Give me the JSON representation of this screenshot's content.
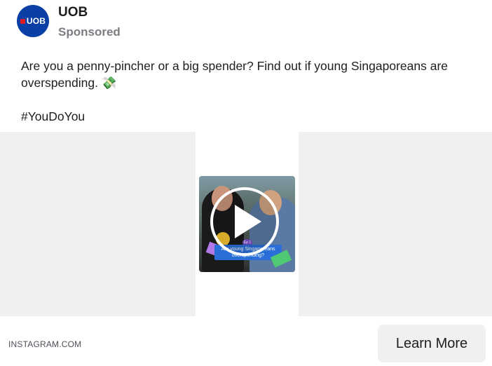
{
  "post": {
    "page_name": "UOB",
    "sponsored_label": "Sponsored",
    "avatar_text": "UOB",
    "caption_text": "Are you a penny-pincher or a big spender? Find out if young Singaporeans are overspending.",
    "caption_emoji": "💸",
    "hashtag": "#YouDoYou"
  },
  "video": {
    "thumbnail_caption": "Are young Singaporeans overspending?",
    "episode_tag": "Ep 1",
    "play_icon": "play-icon"
  },
  "footer": {
    "domain": "INSTAGRAM.COM",
    "cta_label": "Learn More"
  },
  "colors": {
    "brand_blue": "#0a3fa6",
    "brand_red": "#e11b22",
    "button_bg": "#f0f0f0"
  }
}
